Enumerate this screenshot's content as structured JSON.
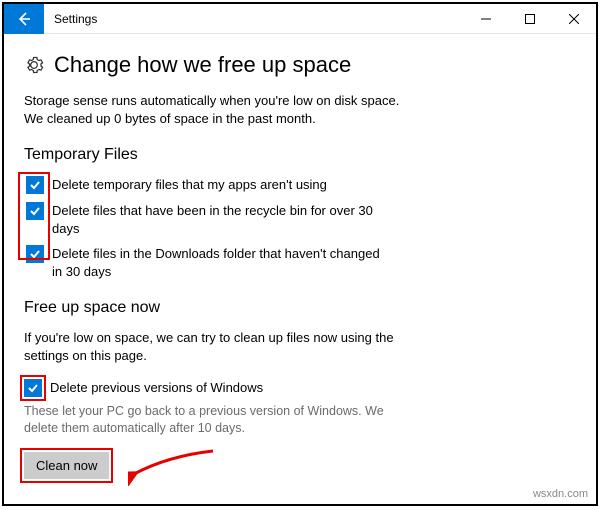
{
  "window": {
    "title": "Settings"
  },
  "page": {
    "title": "Change how we free up space",
    "intro_line1": "Storage sense runs automatically when you're low on disk space.",
    "intro_line2": "We cleaned up 0 bytes of space in the past month."
  },
  "temporary_files": {
    "heading": "Temporary Files",
    "items": [
      {
        "label": "Delete temporary files that my apps aren't using",
        "checked": true
      },
      {
        "label": "Delete files that have been in the recycle bin for over 30 days",
        "checked": true
      },
      {
        "label": "Delete files in the Downloads folder that haven't changed in 30 days",
        "checked": true
      }
    ]
  },
  "free_up": {
    "heading": "Free up space now",
    "description": "If you're low on space, we can try to clean up files now using the settings on this page.",
    "delete_previous": {
      "label": "Delete previous versions of Windows",
      "checked": true
    },
    "note": "These let your PC go back to a previous version of Windows. We delete them automatically after 10 days.",
    "clean_button": "Clean now"
  },
  "watermark": "wsxdn.com"
}
